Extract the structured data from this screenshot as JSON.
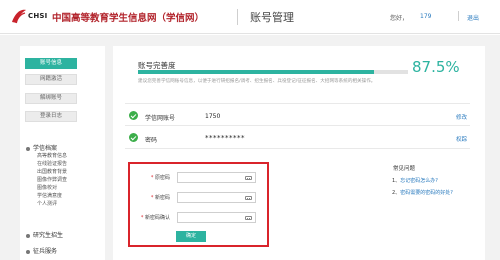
{
  "header": {
    "logo_text": "CHSI",
    "site_name": "中国高等教育学生信息网（学信网）",
    "page_title": "账号管理",
    "greeting": "您好，",
    "user_id": "179",
    "logout": "退出"
  },
  "sidebar": {
    "buttons": [
      {
        "label": "账号信息",
        "active": true
      },
      {
        "label": "网籍激活",
        "active": false
      },
      {
        "label": "解绑账号",
        "active": false
      },
      {
        "label": "登录日志",
        "active": false
      }
    ],
    "sections": [
      {
        "title": "学信档案",
        "items": [
          "高等教育信息",
          "在线验证报告",
          "出国教育背景",
          "图像作弊调查",
          "图像校对",
          "学信满意度",
          "个人测评"
        ]
      },
      {
        "title": "研究生招生",
        "items": []
      },
      {
        "title": "征兵服务",
        "items": []
      }
    ]
  },
  "completeness": {
    "label": "账号完善度",
    "percent": 87.5,
    "percent_text": "87.5%",
    "note": "建议您完善学信网账号信息，以便于进行研招报名/调考、招生报名、兵役登记/征征报名、大招网等系统的相关操作。"
  },
  "rows": [
    {
      "label": "学信网账号",
      "value": "1750",
      "action": "修改"
    },
    {
      "label": "密码",
      "value": "**********",
      "action": "权踪"
    }
  ],
  "form": {
    "fields": [
      {
        "label": "原密码",
        "value": ""
      },
      {
        "label": "新密码",
        "value": ""
      },
      {
        "label": "新密码确认",
        "value": ""
      }
    ],
    "required_mark": "*",
    "submit_label": "确定"
  },
  "faq": {
    "title": "常见问题",
    "items": [
      {
        "num": "1、",
        "text": "忘记密码怎么办?"
      },
      {
        "num": "2、",
        "text": "密码需要的密码的好处?"
      }
    ]
  },
  "colors": {
    "accent": "#2db3a0",
    "brand_red": "#b2232b",
    "highlight_border": "#d9242b",
    "link": "#2a7bbf",
    "check": "#3cae4a"
  }
}
